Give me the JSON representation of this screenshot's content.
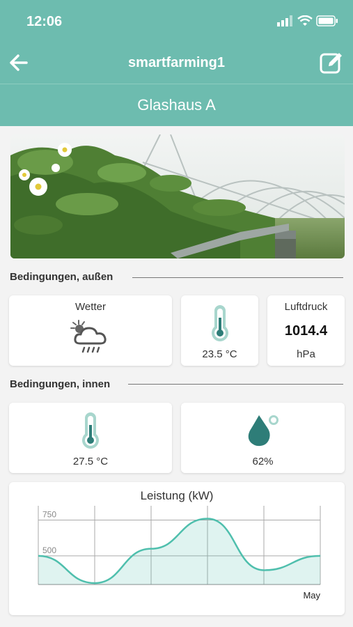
{
  "status": {
    "time": "12:06",
    "icons": [
      "signal-icon",
      "wifi-icon",
      "battery-icon"
    ]
  },
  "nav": {
    "title": "smartfarming1",
    "back_icon": "arrow-left-icon",
    "edit_icon": "edit-icon"
  },
  "header": {
    "title": "Glashaus A"
  },
  "hero": {
    "icon": "greenhouse-photo"
  },
  "outside": {
    "section_title": "Bedingungen, außen",
    "weather_label": "Wetter",
    "weather_icon": "partly-cloudy-rain-icon",
    "temperature": "23.5 °C",
    "pressure_label": "Luftdruck",
    "pressure_value": "1014.4",
    "pressure_unit": "hPa"
  },
  "inside": {
    "section_title": "Bedingungen, innen",
    "temperature": "27.5 °C",
    "humidity": "62%"
  },
  "colors": {
    "primary": "#6dbcaf",
    "accent": "#4fbfad",
    "icon_dark": "#2e7d78"
  },
  "chart_data": {
    "type": "area",
    "title": "Leistung (kW)",
    "x_tick_labels": [
      "",
      "",
      "",
      "",
      "",
      "May"
    ],
    "y_ticks": [
      500,
      750
    ],
    "ylim": [
      300,
      850
    ],
    "grid": true,
    "series": [
      {
        "values": [
          500,
          310,
          550,
          760,
          400,
          500
        ]
      }
    ]
  }
}
